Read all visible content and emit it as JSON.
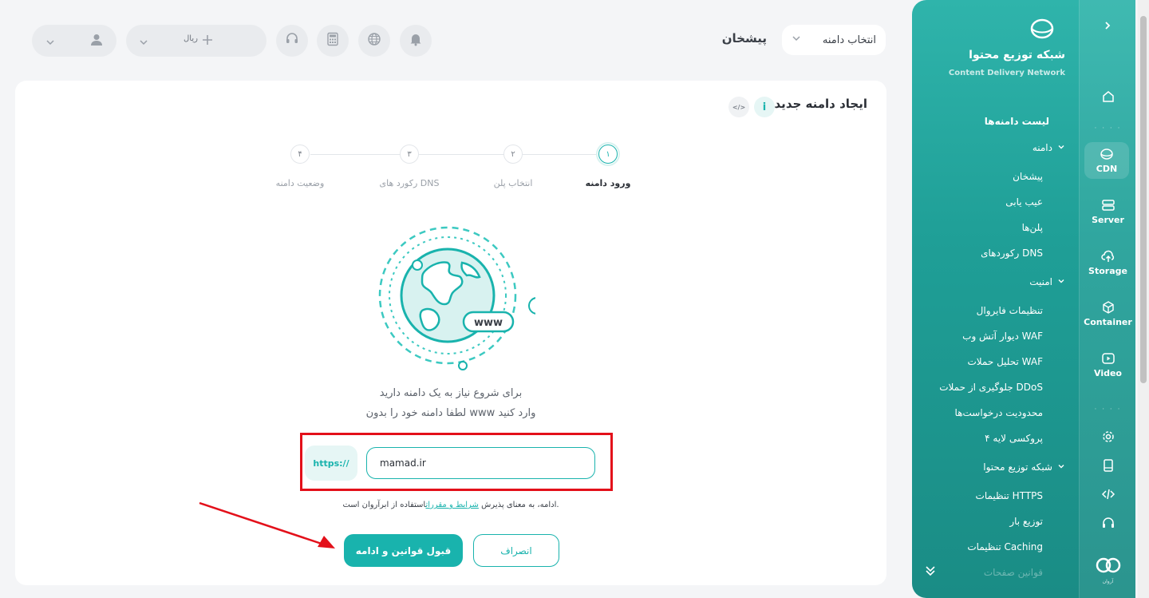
{
  "header": {
    "page_title": "پیشخان",
    "domain_select": "انتخاب دامنه",
    "currency_label": "ریال",
    "icons": [
      "user-icon",
      "plus-icon",
      "headset-icon",
      "calculator-icon",
      "globe-icon",
      "bell-icon"
    ]
  },
  "card": {
    "title": "ایجاد دامنه جدید",
    "info": "i",
    "code": "</>"
  },
  "stepper": {
    "steps": [
      {
        "num": "۱",
        "label": "ورود دامنه"
      },
      {
        "num": "۲",
        "label": "انتخاب پلن"
      },
      {
        "num": "۳",
        "label": "رکورد های DNS"
      },
      {
        "num": "۴",
        "label": "وضعیت دامنه"
      }
    ]
  },
  "illustration": {
    "badge": "www"
  },
  "form": {
    "desc_line1": "برای شروع نیاز به یک دامنه دارید",
    "desc_line2": "لطفا دامنه خود را بدون www وارد کنید",
    "prefix": "https://",
    "domain_value": "mamad.ir",
    "terms_before": "ادامه، به معنای پذیرش ",
    "terms_link": "شرایط و مقررات",
    "terms_after": "استفاده از ابرآروان است.",
    "accept_button": "قبول قوانین و ادامه",
    "cancel_button": "انصراف"
  },
  "sidebar": {
    "brand_title": "شبکه توزیع محتوا",
    "brand_subtitle": "Content Delivery Network",
    "domain_list": "لیست دامنه‌ها",
    "group_domain": "دامنه",
    "domain_items": [
      "پیشخان",
      "عیب یابی",
      "پلن‌ها",
      "رکوردهای DNS"
    ],
    "group_security": "امنیت",
    "security_items": [
      "تنظیمات فایروال",
      "دیوار آتش وب WAF",
      "تحلیل حملات WAF",
      "جلوگیری از حملات DDoS",
      "محدودیت درخواست‌ها",
      "پروکسی لایه ۴"
    ],
    "group_cdn": "شبکه توزیع محتوا",
    "cdn_items": [
      "تنظیمات HTTPS",
      "توزیع بار",
      "تنظیمات Caching",
      "قوانین صفحات"
    ],
    "rail": [
      "CDN",
      "Server",
      "Storage",
      "Container",
      "Video"
    ],
    "dots": "· · · ·",
    "logo_text": "آروان"
  },
  "colors": {
    "accent": "#19b3ad",
    "annotation": "#e3101a"
  }
}
